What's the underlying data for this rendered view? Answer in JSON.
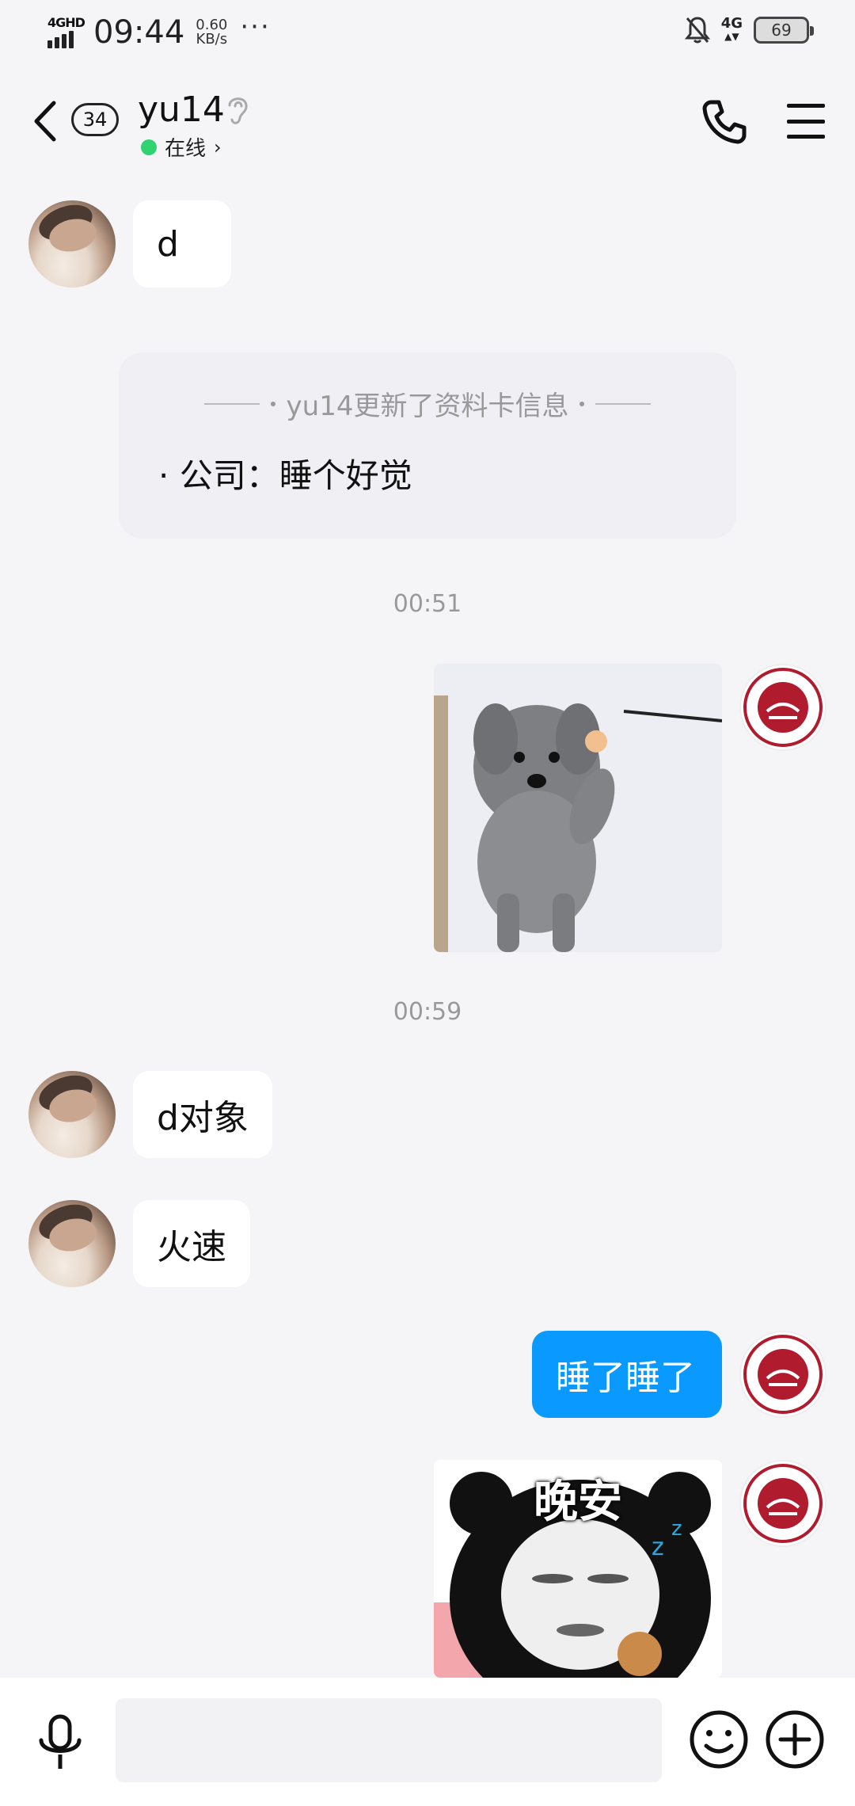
{
  "status_bar": {
    "network": "4GHD",
    "time": "09:44",
    "speed_value": "0.60",
    "speed_unit": "KB/s",
    "more": "···",
    "net_right": "4G",
    "battery": "69"
  },
  "header": {
    "badge_count": "34",
    "contact_name": "yu14",
    "status_text": "在线",
    "status_chevron": "›"
  },
  "messages": {
    "m1": "d",
    "profile_title": "yu14更新了资料卡信息",
    "profile_field": "· 公司：睡个好觉",
    "ts1": "00:51",
    "ts2": "00:59",
    "m2": "d对象",
    "m3": "火速",
    "m4": "睡了睡了",
    "sticker_caption": "晚安"
  },
  "icons": {
    "back": "chevron-left-icon",
    "ear": "ear-icon",
    "call": "phone-icon",
    "menu": "menu-icon",
    "mic": "microphone-icon",
    "emoji": "smiley-icon",
    "plus": "plus-icon",
    "mute": "bell-off-icon"
  },
  "colors": {
    "accent": "#0a99ff",
    "online": "#2fd36f",
    "background": "#f5f5f7"
  }
}
